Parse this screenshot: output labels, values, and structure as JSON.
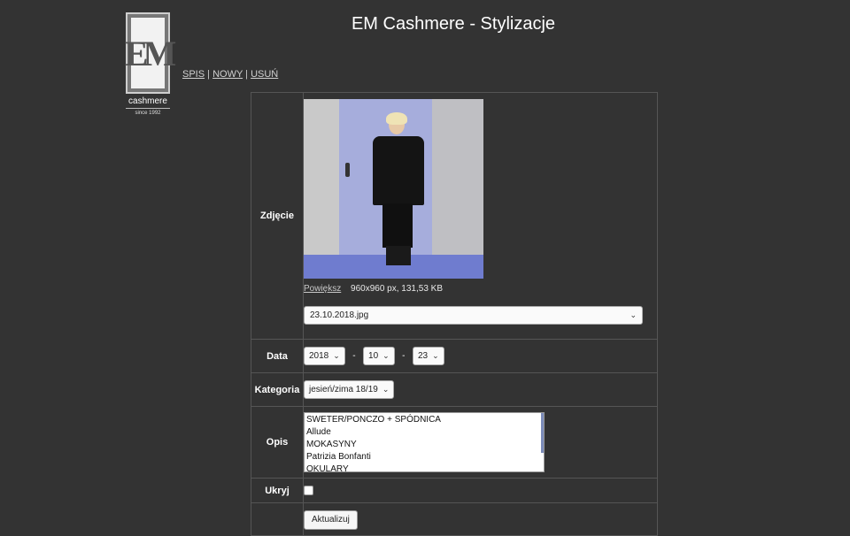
{
  "title": "EM Cashmere - Stylizacje",
  "logo": {
    "mark": "EM",
    "name": "cashmere",
    "since": "since 1992"
  },
  "nav": {
    "items": [
      "SPIS",
      "NOWY",
      "USUŃ"
    ],
    "sep": "|"
  },
  "form": {
    "photo": {
      "label": "Zdjęcie",
      "enlarge_link": "Powiększ",
      "info": "960x960 px, 131,53 KB",
      "file_select_value": "23.10.2018.jpg"
    },
    "date": {
      "label": "Data",
      "year": "2018",
      "month": "10",
      "day": "23",
      "sep": "-"
    },
    "category": {
      "label": "Kategoria",
      "value": "jesień/zima 18/19"
    },
    "description": {
      "label": "Opis",
      "lines": [
        "SWETER/PONCZO + SPÓDNICA",
        "Allude",
        "MOKASYNY",
        "Patrizia Bonfanti",
        "OKULARY"
      ]
    },
    "hide": {
      "label": "Ukryj"
    },
    "submit": {
      "label": "Aktualizuj"
    }
  }
}
